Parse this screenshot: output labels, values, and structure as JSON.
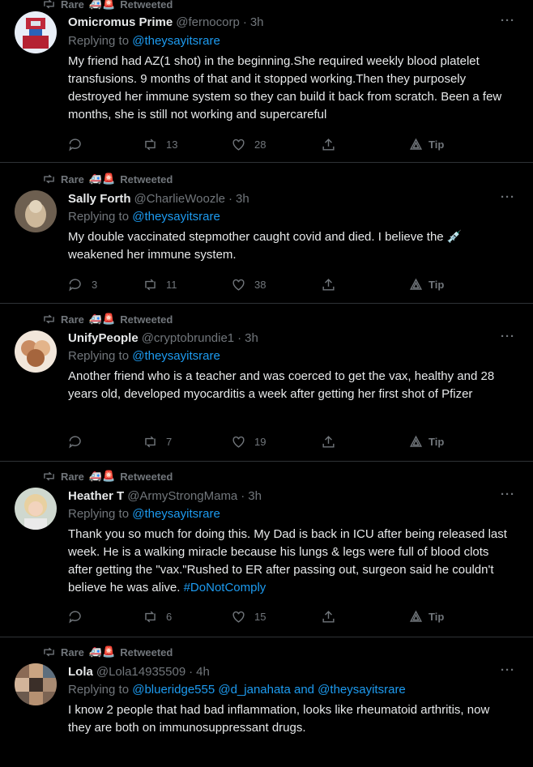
{
  "retweet_label": "Retweeted",
  "retweeter": "Rare",
  "retweeter_emoji": "🚑🚨",
  "tip_label": "Tip",
  "more_label": "···",
  "tweets": [
    {
      "name": "Omicromus Prime",
      "handle": "@fernocorp",
      "time": "3h",
      "replying_prefix": "Replying to",
      "replying_to": "@theysayitsrare",
      "text": "My friend had AZ(1 shot) in the beginning.She required weekly blood platelet transfusions. 9 months of that and it stopped working.Then they purposely destroyed her immune system so they can build it back from scratch. Been a few months, she is still not working and supercareful",
      "replies": "",
      "retweets": "13",
      "likes": "28"
    },
    {
      "name": "Sally Forth",
      "handle": "@CharlieWoozle",
      "time": "3h",
      "replying_prefix": "Replying to",
      "replying_to": "@theysayitsrare",
      "text": "My double vaccinated stepmother caught covid and died. I believe the 💉 weakened her immune system.",
      "replies": "3",
      "retweets": "11",
      "likes": "38"
    },
    {
      "name": "UnifyPeople",
      "handle": "@cryptobrundie1",
      "time": "3h",
      "replying_prefix": "Replying to",
      "replying_to": "@theysayitsrare",
      "text": "Another friend who is a teacher and was coerced to get the vax, healthy and 28 years old, developed myocarditis a week after getting her first shot of Pfizer",
      "replies": "",
      "retweets": "7",
      "likes": "19"
    },
    {
      "name": "Heather T",
      "handle": "@ArmyStrongMama",
      "time": "3h",
      "replying_prefix": "Replying to",
      "replying_to": "@theysayitsrare",
      "text": "Thank you so much for doing this. My Dad is back in ICU after being released last week. He is a walking miracle because his lungs & legs were full of blood clots after getting the \"vax.\"Rushed to ER after passing out, surgeon said he couldn't believe he was alive.",
      "hashtag": "#DoNotComply",
      "replies": "",
      "retweets": "6",
      "likes": "15"
    },
    {
      "name": "Lola",
      "handle": "@Lola14935509",
      "time": "4h",
      "replying_prefix": "Replying to",
      "replying_to": "@blueridge555 @d_janahata and @theysayitsrare",
      "text": "I know 2 people that had bad inflammation, looks like rheumatoid arthritis, now they are both on immunosuppressant drugs."
    }
  ]
}
